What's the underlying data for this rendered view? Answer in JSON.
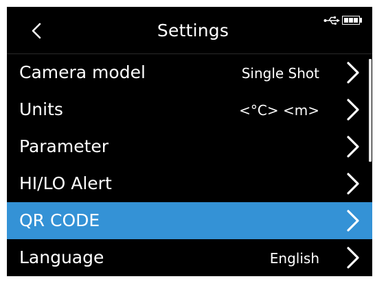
{
  "header": {
    "title": "Settings",
    "back_icon": "chevron-left-icon",
    "status_icons": [
      "usb-icon",
      "battery-icon"
    ]
  },
  "battery": {
    "bars_filled": 3,
    "bars_total": 3
  },
  "menu": {
    "items": [
      {
        "label": "Camera model",
        "value": "Single Shot",
        "selected": false
      },
      {
        "label": "Units",
        "value": "<°C> <m>",
        "selected": false
      },
      {
        "label": "Parameter",
        "selected": false
      },
      {
        "label": "HI/LO Alert",
        "selected": false
      },
      {
        "label": "QR CODE",
        "selected": true
      },
      {
        "label": "Language",
        "value": "English",
        "selected": false
      }
    ],
    "row_icon": "chevron-right-icon"
  },
  "colors": {
    "background": "#000000",
    "text": "#ffffff",
    "selected": "#3492d6"
  }
}
